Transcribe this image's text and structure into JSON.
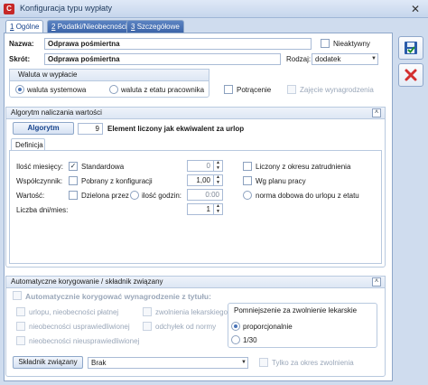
{
  "window": {
    "title": "Konfiguracja typu wypłaty",
    "close_glyph": "✕",
    "app_icon_letter": "C"
  },
  "tabs": [
    {
      "num": "1",
      "label": "Ogólne"
    },
    {
      "num": "2",
      "label": "Podatki/Nieobecności"
    },
    {
      "num": "3",
      "label": "Szczegółowe"
    }
  ],
  "general": {
    "name_label": "Nazwa:",
    "name_value": "Odprawa pośmiertna",
    "inactive_label": "Nieaktywny",
    "short_label": "Skrót:",
    "short_value": "Odprawa pośmiertna",
    "kind_label": "Rodzaj:",
    "kind_value": "dodatek",
    "currency_group": "Waluta w wypłacie",
    "currency_system": "waluta systemowa",
    "currency_contract": "waluta z etatu pracownika",
    "deduction_label": "Potrącenie",
    "seizure_label": "Zajęcie wynagrodzenia"
  },
  "algorithm": {
    "section_title": "Algorytm naliczania wartości",
    "button_label": "Algorytm",
    "number": "9",
    "description": "Element liczony jak ekwiwalent za urlop",
    "def_tab": "Definicja",
    "months_label": "Ilość miesięcy:",
    "standard_label": "Standardowa",
    "months_value": "0",
    "contract_label": "Liczony z okresu zatrudnienia",
    "coef_label": "Współczynnik:",
    "from_config_label": "Pobrany z konfiguracji",
    "coef_value": "1,00",
    "work_plan_label": "Wg planu pracy",
    "value_label": "Wartość:",
    "divided_label": "Dzielona przez",
    "hours_label": "ilość godzin:",
    "hours_value": "0:00",
    "norm_label": "norma dobowa do urlopu z etatu",
    "days_label": "Liczba dni/mies:",
    "days_value": "1"
  },
  "auto": {
    "section_title": "Automatyczne korygowanie / składnik związany",
    "main_check": "Automatycznie korygować wynagrodzenie z tytułu:",
    "items": [
      "urlopu, nieobecności płatnej",
      "nieobecności usprawiedliwionej",
      "nieobecności nieusprawiedliwionej",
      "zwolnienia lekarskiego",
      "odchyłek od normy"
    ],
    "reduction_group": "Pomniejszenie za zwolnienie lekarskie",
    "proportional": "proporcjonalnie",
    "fraction": "1/30",
    "linked_button": "Składnik związany",
    "linked_value": "Brak",
    "only_period": "Tylko za okres zwolnienia"
  },
  "colors": {
    "accent": "#15428b",
    "tab_inactive": "#3c65a9",
    "cancel": "#d32f2f",
    "ok": "#2a5caa"
  }
}
